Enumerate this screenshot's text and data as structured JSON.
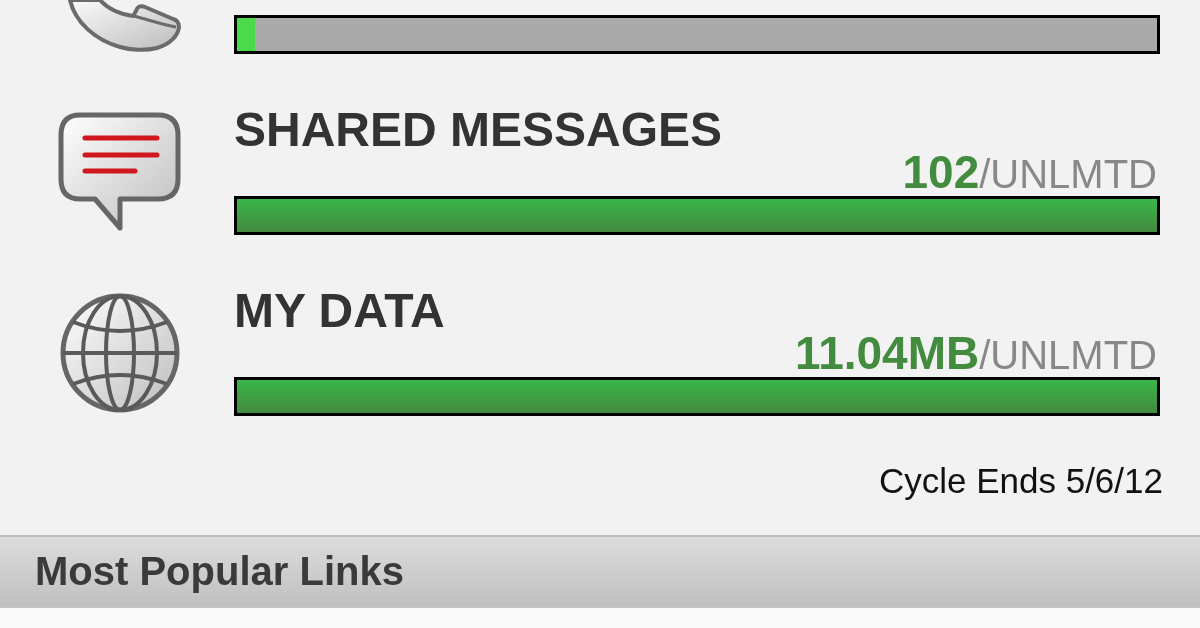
{
  "usage": [
    {
      "kind": "calls",
      "level": 0.02
    },
    {
      "kind": "messages",
      "title": "SHARED MESSAGES",
      "used": "102",
      "limit": "/UNLMTD",
      "level": 1
    },
    {
      "kind": "data",
      "title": "MY DATA",
      "used": "11.04MB",
      "limit": "/UNLMTD",
      "level": 1
    }
  ],
  "cycle_end": "Cycle Ends 5/6/12",
  "section": {
    "title": "Most Popular Links"
  }
}
